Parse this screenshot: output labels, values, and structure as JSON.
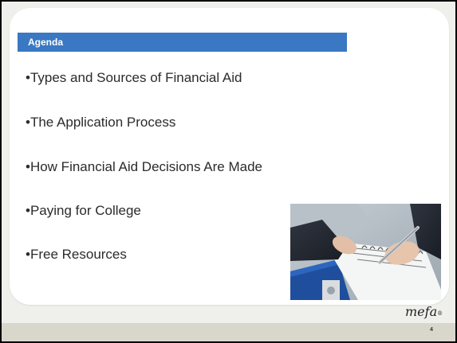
{
  "slide": {
    "heading": "Agenda",
    "items": [
      "•Types and Sources of Financial Aid",
      "•The Application Process",
      "•How Financial Aid Decisions Are Made",
      "•Paying for College",
      "•Free Resources"
    ],
    "image": {
      "icon": "person-writing-with-pen-on-notepad-photo"
    }
  },
  "footer": {
    "logo_text": "mefa",
    "logo_mark": "®",
    "page_number": "4"
  },
  "colors": {
    "agenda_bar": "#3a78c3",
    "panel": "#ffffff",
    "background": "#efefec",
    "footer_band": "#d9d6cb",
    "text": "#2b2b2b"
  }
}
